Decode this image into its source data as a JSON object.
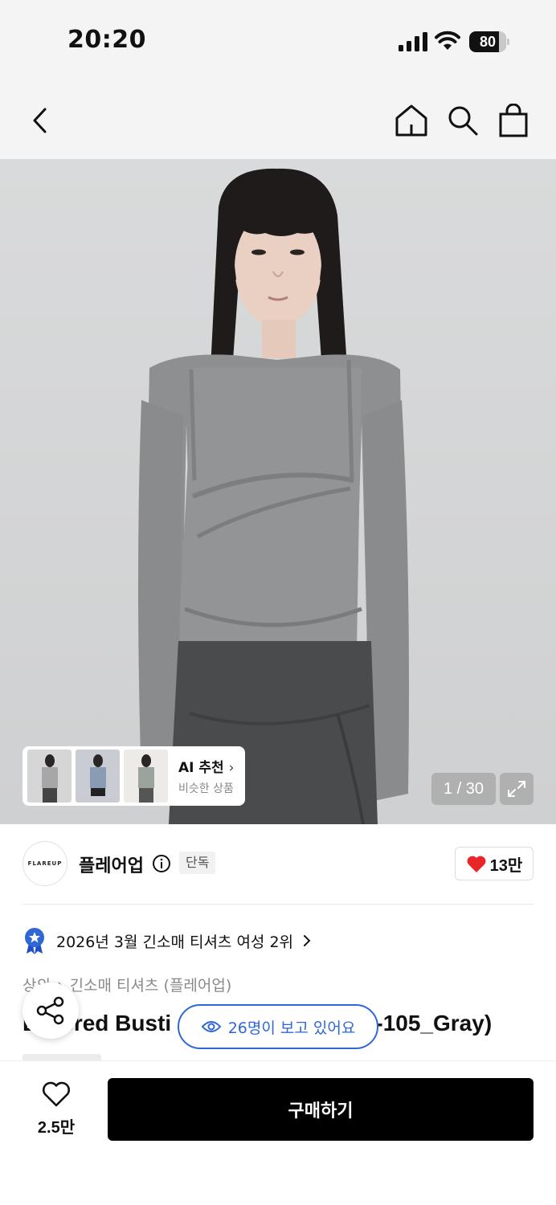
{
  "status_bar": {
    "time": "20:20",
    "battery": "80",
    "battery_level": 0.8
  },
  "nav": {
    "back_icon": "chevron-left-icon",
    "home_icon": "home-icon",
    "search_icon": "search-icon",
    "bag_icon": "shopping-bag-icon"
  },
  "gallery": {
    "counter": "1 / 30",
    "ai_card": {
      "title": "AI 추천",
      "subtitle": "비슷한 상품"
    }
  },
  "brand": {
    "logo_text": "FLAREUP",
    "name": "플레어업",
    "badge": "단독",
    "like_count": "13만"
  },
  "ranking": {
    "text": "2026년 3월 긴소매 티셔츠 여성 2위"
  },
  "breadcrumb": {
    "category": "상의",
    "subcategory": "긴소매 티셔츠 (플레어업)"
  },
  "product": {
    "title_left": "Layered Busti",
    "title_right": "FL-105_Gray)"
  },
  "viewers": {
    "text": "26명이 보고 있어요"
  },
  "bottom": {
    "wish_count": "2.5만",
    "buy_label": "구매하기"
  },
  "colors": {
    "accent_blue": "#2f67d6",
    "heart_red": "#e8262a",
    "buy_bg": "#000000"
  }
}
